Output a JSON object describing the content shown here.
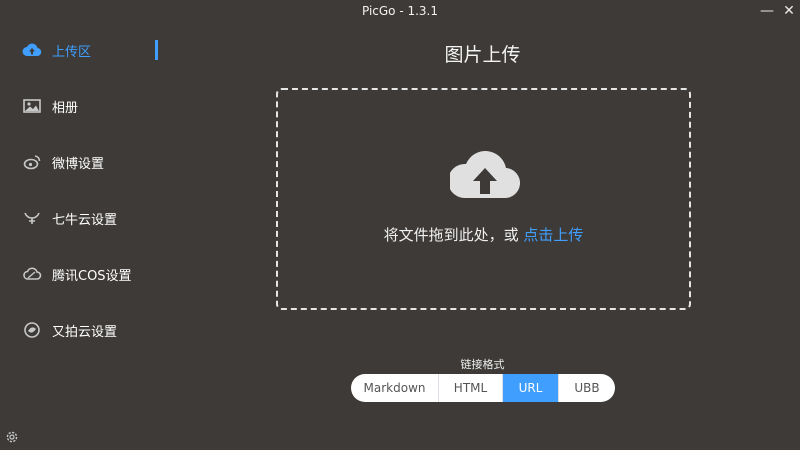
{
  "window": {
    "title": "PicGo - 1.3.1",
    "minimize_glyph": "—",
    "close_glyph": "✕"
  },
  "sidebar": {
    "items": [
      {
        "label": "上传区",
        "icon": "cloud-upload-icon",
        "active": true
      },
      {
        "label": "相册",
        "icon": "image-icon",
        "active": false
      },
      {
        "label": "微博设置",
        "icon": "weibo-icon",
        "active": false
      },
      {
        "label": "七牛云设置",
        "icon": "qiniu-icon",
        "active": false
      },
      {
        "label": "腾讯COS设置",
        "icon": "tencent-cloud-icon",
        "active": false
      },
      {
        "label": "又拍云设置",
        "icon": "upyun-icon",
        "active": false
      }
    ],
    "settings_icon": "gear-icon"
  },
  "main": {
    "title": "图片上传",
    "dropzone": {
      "text": "将文件拖到此处，或 ",
      "link": "点击上传",
      "icon": "cloud-upload-icon"
    },
    "link_format": {
      "label": "链接格式",
      "options": [
        "Markdown",
        "HTML",
        "URL",
        "UBB"
      ],
      "selected": "URL"
    }
  },
  "colors": {
    "background": "#3d3a37",
    "accent": "#409eff",
    "text": "#ffffff",
    "icon_gray": "#c8c8c8"
  }
}
